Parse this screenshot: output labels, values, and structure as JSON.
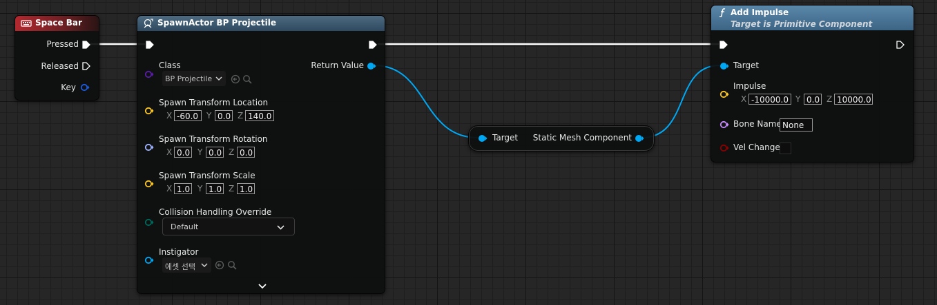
{
  "colors": {
    "exec": "#ffffff",
    "object_pin": "#00a8f4",
    "class_pin": "#5a1ea8",
    "vector_pin": "#fdc826",
    "rotator_pin": "#a0b4ff",
    "enum_pin": "#00685a",
    "name_pin": "#c98bff",
    "bool_pin": "#8e0000",
    "key_pin": "#1e5bd8"
  },
  "space_bar_node": {
    "title": "Space Bar",
    "icon": "keyboard-icon",
    "pins": {
      "pressed": "Pressed",
      "released": "Released",
      "key": "Key"
    }
  },
  "spawn_node": {
    "title": "SpawnActor BP Projectile",
    "icon": "spawn-actor-icon",
    "class_label": "Class",
    "class_value": "BP Projectile",
    "location_label": "Spawn Transform Location",
    "location": {
      "x": "-60.0",
      "y": "0.0",
      "z": "140.0"
    },
    "rotation_label": "Spawn Transform Rotation",
    "rotation": {
      "x": "0.0",
      "y": "0.0",
      "z": "0.0"
    },
    "scale_label": "Spawn Transform Scale",
    "scale": {
      "x": "1.0",
      "y": "1.0",
      "z": "1.0"
    },
    "collision_label": "Collision Handling Override",
    "collision_value": "Default",
    "instigator_label": "Instigator",
    "instigator_value": "에셋 선택",
    "return_value_label": "Return Value",
    "axis": {
      "x": "X",
      "y": "Y",
      "z": "Z"
    }
  },
  "getter_node": {
    "input_label": "Target",
    "output_label": "Static Mesh Component"
  },
  "impulse_node": {
    "title": "Add Impulse",
    "subtitle": "Target is Primitive Component",
    "icon": "function-icon",
    "target_label": "Target",
    "impulse_label": "Impulse",
    "impulse": {
      "x": "-10000.0",
      "y": "0.0",
      "z": "10000.0"
    },
    "bone_name_label": "Bone Name",
    "bone_name_value": "None",
    "vel_change_label": "Vel Change",
    "vel_change_value": false,
    "axis": {
      "x": "X",
      "y": "Y",
      "z": "Z"
    }
  }
}
